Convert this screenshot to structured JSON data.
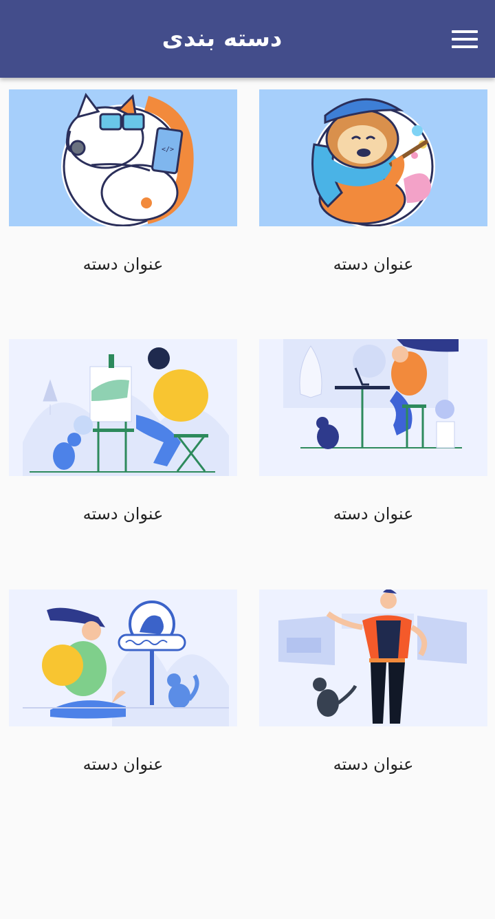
{
  "header": {
    "title": "دسته بندی",
    "menu_icon": "hamburger-menu-icon"
  },
  "categories": [
    {
      "label": "عنوان دسته",
      "illustration": "sloth-artist-sticker"
    },
    {
      "label": "عنوان دسته",
      "illustration": "cat-programmer-sticker"
    },
    {
      "label": "عنوان دسته",
      "illustration": "woman-laptop-cat-illustration"
    },
    {
      "label": "عنوان دسته",
      "illustration": "man-painting-easel-illustration"
    },
    {
      "label": "عنوان دسته",
      "illustration": "man-presenting-cat-illustration"
    },
    {
      "label": "عنوان دسته",
      "illustration": "woman-bus-stop-cat-illustration"
    }
  ],
  "colors": {
    "appbar": "#434d8b",
    "sticker_bg": "#a6cffb",
    "scene_bg": "#eef2ff"
  }
}
